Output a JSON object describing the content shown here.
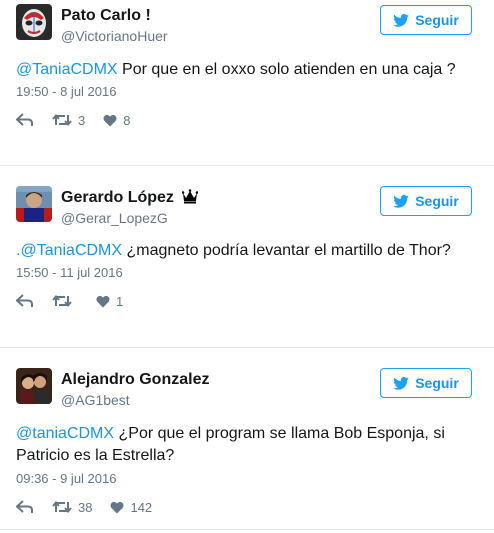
{
  "colors": {
    "accent": "#1da1f2",
    "link": "#1b95e0",
    "muted": "#657786",
    "divider": "#e1e8ed"
  },
  "tweets": [
    {
      "name": "Pato Carlo !",
      "handle": "@VictorianoHuer",
      "follow_label": "Seguir",
      "mention": "@TaniaCDMX",
      "text": " Por que en el oxxo solo atienden en una caja ?",
      "time": "19:50 - 8 jul 2016",
      "retweets": "3",
      "likes": "8"
    },
    {
      "name": "Gerardo López",
      "handle": "@Gerar_LopezG",
      "follow_label": "Seguir",
      "mention": ".@TaniaCDMX",
      "text": " ¿magneto podría levantar el martillo de Thor?",
      "time": "15:50 - 11 jul 2016",
      "retweets": "",
      "likes": "1"
    },
    {
      "name": "Alejandro Gonzalez",
      "handle": "@AG1best",
      "follow_label": "Seguir",
      "mention": "@taniaCDMX",
      "text": " ¿Por que el program se llama Bob Esponja, si Patricio es la Estrella?",
      "time": "09:36 - 9 jul 2016",
      "retweets": "38",
      "likes": "142"
    }
  ]
}
